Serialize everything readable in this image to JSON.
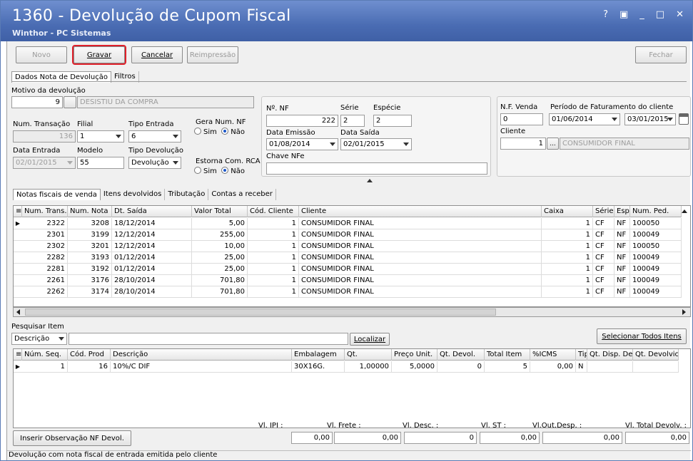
{
  "window": {
    "title": "1360 - Devolução de Cupom Fiscal",
    "subtitle": "Winthor - PC Sistemas",
    "controls": [
      "?",
      "▣",
      "_",
      "□",
      "✕"
    ]
  },
  "toolbar": {
    "novo": "Novo",
    "gravar": "Gravar",
    "cancelar": "Cancelar",
    "reimpressao": "Reimpressão",
    "fechar": "Fechar"
  },
  "main_tabs": [
    "Dados Nota de Devolução",
    "Filtros"
  ],
  "form": {
    "motivo_label": "Motivo da devolução",
    "motivo_code": "9",
    "motivo_desc": "DESISTIU DA COMPRA",
    "num_transacao_label": "Num. Transação",
    "num_transacao": "136",
    "filial_label": "Filial",
    "filial": "1",
    "tipo_entrada_label": "Tipo Entrada",
    "tipo_entrada": "6",
    "data_entrada_label": "Data Entrada",
    "data_entrada": "02/01/2015",
    "modelo_label": "Modelo",
    "modelo": "55",
    "tipo_devolucao_label": "Tipo Devolução",
    "tipo_devolucao": "Devolução",
    "gera_num_nf_label": "Gera Num. NF",
    "estorna_rca_label": "Estorna Com. RCA",
    "sim": "Sim",
    "nao": "Não",
    "nf_label": "Nº. NF",
    "nf": "222",
    "serie_label": "Série",
    "serie": "2",
    "especie_label": "Espécie",
    "especie": "2",
    "data_emissao_label": "Data Emissão",
    "data_emissao": "01/08/2014",
    "data_saida_label": "Data Saída",
    "data_saida": "02/01/2015",
    "chave_nfe_label": "Chave NFe",
    "chave_nfe": "",
    "nf_venda_label": "N.F. Venda",
    "nf_venda": "0",
    "periodo_label": "Período de Faturamento do cliente",
    "periodo_ini": "01/06/2014",
    "periodo_fim": "03/01/2015",
    "cliente_label": "Cliente",
    "cliente_code": "1",
    "cliente_nome": "CONSUMIDOR FINAL"
  },
  "sub_tabs": [
    "Notas fiscais de venda",
    "Itens devolvidos",
    "Tributação",
    "Contas a receber"
  ],
  "notas_grid": {
    "headers": [
      "Num. Trans.",
      "Num. Nota",
      "Dt. Saída",
      "Valor Total",
      "Cód. Cliente",
      "Cliente",
      "Caixa",
      "Série",
      "Esp",
      "Num. Ped."
    ],
    "rows": [
      [
        "2322",
        "3208",
        "18/12/2014",
        "5,00",
        "1",
        "CONSUMIDOR FINAL",
        "1",
        "CF",
        "NF",
        "100050"
      ],
      [
        "2301",
        "3199",
        "12/12/2014",
        "255,00",
        "1",
        "CONSUMIDOR FINAL",
        "1",
        "CF",
        "NF",
        "100049"
      ],
      [
        "2302",
        "3201",
        "12/12/2014",
        "10,00",
        "1",
        "CONSUMIDOR FINAL",
        "1",
        "CF",
        "NF",
        "100050"
      ],
      [
        "2282",
        "3193",
        "01/12/2014",
        "25,00",
        "1",
        "CONSUMIDOR FINAL",
        "1",
        "CF",
        "NF",
        "100049"
      ],
      [
        "2281",
        "3192",
        "01/12/2014",
        "25,00",
        "1",
        "CONSUMIDOR FINAL",
        "1",
        "CF",
        "NF",
        "100049"
      ],
      [
        "2261",
        "3176",
        "28/10/2014",
        "701,80",
        "1",
        "CONSUMIDOR FINAL",
        "1",
        "CF",
        "NF",
        "100049"
      ],
      [
        "2262",
        "3174",
        "28/10/2014",
        "701,80",
        "1",
        "CONSUMIDOR FINAL",
        "1",
        "CF",
        "NF",
        "100049"
      ]
    ]
  },
  "search": {
    "label": "Pesquisar Item",
    "field": "Descrição",
    "value": "",
    "localizar": "Localizar",
    "selecionar_todos": "Selecionar Todos Itens"
  },
  "itens_grid": {
    "headers": [
      "Núm. Seq.",
      "Cód. Prod",
      "Descrição",
      "Embalagem",
      "Qt.",
      "Preço Unit.",
      "Qt. Devol.",
      "Total Item",
      "%ICMS",
      "Tip",
      "Qt. Disp. De",
      "Qt. Devolvic"
    ],
    "rows": [
      [
        "1",
        "16",
        "10%/C DIF",
        "30X16G.",
        "1,00000",
        "5,0000",
        "0",
        "5",
        "0,00",
        "N",
        "",
        ""
      ]
    ]
  },
  "totals": {
    "inserir_obs": "Inserir Observação NF Devol.",
    "ipi_label": "Vl. IPI :",
    "ipi": "0,00",
    "frete_label": "Vl. Frete :",
    "frete": "0,00",
    "desc_label": "Vl. Desc. :",
    "desc": "0",
    "st_label": "Vl. ST :",
    "st": "0,00",
    "outdesp_label": "Vl.Out.Desp. :",
    "outdesp": "0,00",
    "total_label": "Vl. Total Devolv. :",
    "total": "0,00"
  },
  "status": "Devolução com nota fiscal de entrada emitida pelo cliente"
}
